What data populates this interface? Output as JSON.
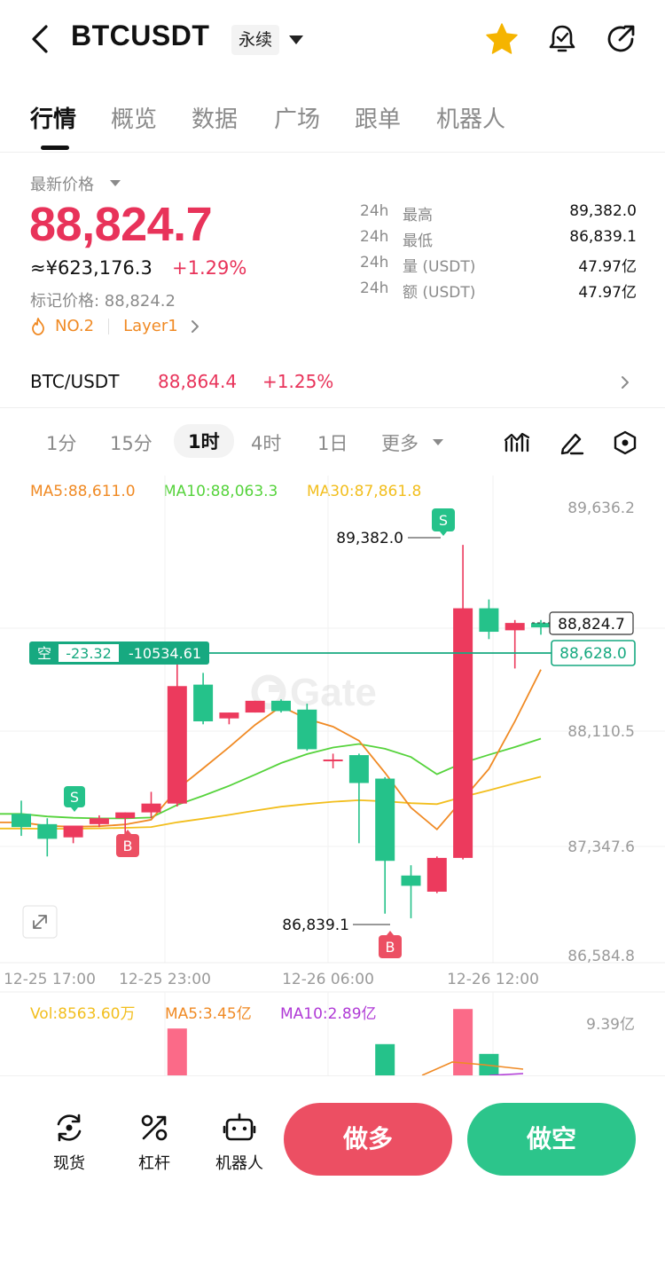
{
  "header": {
    "symbol": "BTCUSDT",
    "contract_type": "永续"
  },
  "tabs": [
    {
      "label": "行情",
      "active": true
    },
    {
      "label": "概览"
    },
    {
      "label": "数据"
    },
    {
      "label": "广场"
    },
    {
      "label": "跟单"
    },
    {
      "label": "机器人"
    }
  ],
  "price": {
    "last_label": "最新价格",
    "last": "88,824.7",
    "cny": "≈¥623,176.3",
    "change": "+1.29%",
    "mark": "标记价格: 88,824.2",
    "rank": "NO.2",
    "category": "Layer1"
  },
  "stats": [
    {
      "period": "24h",
      "label": "最高",
      "value": "89,382.0"
    },
    {
      "period": "24h",
      "label": "最低",
      "value": "86,839.1"
    },
    {
      "period": "24h",
      "label": "量 (USDT)",
      "value": "47.97亿"
    },
    {
      "period": "24h",
      "label": "额 (USDT)",
      "value": "47.97亿"
    }
  ],
  "spot": {
    "pair": "BTC/USDT",
    "price": "88,864.4",
    "change": "+1.25%"
  },
  "timeframes": [
    {
      "label": "1分"
    },
    {
      "label": "15分"
    },
    {
      "label": "1时",
      "active": true
    },
    {
      "label": "4时"
    },
    {
      "label": "1日"
    },
    {
      "label": "更多"
    }
  ],
  "indicators": {
    "ma5": "MA5:88,611.0",
    "ma10": "MA10:88,063.3",
    "ma30": "MA30:87,861.8",
    "vol": "Vol:8563.60万",
    "vol_ma5": "MA5:3.45亿",
    "vol_ma10": "MA10:2.89亿",
    "vol_axis": "9.39亿"
  },
  "colors": {
    "up": "#ec3a5d",
    "down": "#25c28a",
    "ma5": "#f08a24",
    "ma10": "#56d33c",
    "ma30": "#f2be1d",
    "vol_ma10": "#b03ad6"
  },
  "chart_data": {
    "type": "candlestick",
    "y_ticks": [
      "89,636.2",
      "88,110.5",
      "87,347.6",
      "86,584.8"
    ],
    "ylim": [
      86584.8,
      89636.2
    ],
    "x_ticks": [
      "12-25 17:00",
      "12-25 23:00",
      "12-26 06:00",
      "12-26 12:00"
    ],
    "current_price_label": "88,824.7",
    "position_price_label": "88,628.0",
    "high_label": "89,382.0",
    "low_label": "86,839.1",
    "position": {
      "side": "空",
      "pnl": "-23.32",
      "amount": "-10534.61"
    },
    "markers": [
      "S",
      "B",
      "S",
      "B"
    ],
    "candles": [
      {
        "o": 87550,
        "h": 87640,
        "l": 87400,
        "c": 87460
      },
      {
        "o": 87480,
        "h": 87520,
        "l": 87260,
        "c": 87380
      },
      {
        "o": 87390,
        "h": 87470,
        "l": 87350,
        "c": 87470
      },
      {
        "o": 87480,
        "h": 87540,
        "l": 87460,
        "c": 87520
      },
      {
        "o": 87520,
        "h": 87560,
        "l": 87360,
        "c": 87560
      },
      {
        "o": 87560,
        "h": 87700,
        "l": 87520,
        "c": 87620
      },
      {
        "o": 87620,
        "h": 88650,
        "l": 87600,
        "c": 88420
      },
      {
        "o": 88430,
        "h": 88510,
        "l": 88160,
        "c": 88180
      },
      {
        "o": 88200,
        "h": 88240,
        "l": 88160,
        "c": 88240
      },
      {
        "o": 88240,
        "h": 88320,
        "l": 88240,
        "c": 88320
      },
      {
        "o": 88320,
        "h": 88330,
        "l": 88240,
        "c": 88250
      },
      {
        "o": 88260,
        "h": 88300,
        "l": 87980,
        "c": 87990
      },
      {
        "o": 87910,
        "h": 87960,
        "l": 87860,
        "c": 87920
      },
      {
        "o": 87950,
        "h": 87960,
        "l": 87350,
        "c": 87760
      },
      {
        "o": 87790,
        "h": 87800,
        "l": 86870,
        "c": 87230
      },
      {
        "o": 87130,
        "h": 87200,
        "l": 86839,
        "c": 87060
      },
      {
        "o": 87020,
        "h": 87260,
        "l": 87010,
        "c": 87250
      },
      {
        "o": 87250,
        "h": 89382,
        "l": 87240,
        "c": 88950
      },
      {
        "o": 88950,
        "h": 89010,
        "l": 88740,
        "c": 88790
      },
      {
        "o": 88800,
        "h": 88870,
        "l": 88540,
        "c": 88850
      },
      {
        "o": 88850,
        "h": 88870,
        "l": 88770,
        "c": 88820
      }
    ],
    "volumes": [
      0,
      0,
      0,
      0,
      0,
      0,
      2.4,
      0,
      0,
      0,
      0,
      0,
      0,
      0,
      1.6,
      0,
      0,
      3.4,
      1.1,
      0,
      0
    ]
  },
  "bottom": {
    "spot_label": "现货",
    "margin_label": "杠杆",
    "bot_label": "机器人",
    "long_label": "做多",
    "short_label": "做空"
  }
}
